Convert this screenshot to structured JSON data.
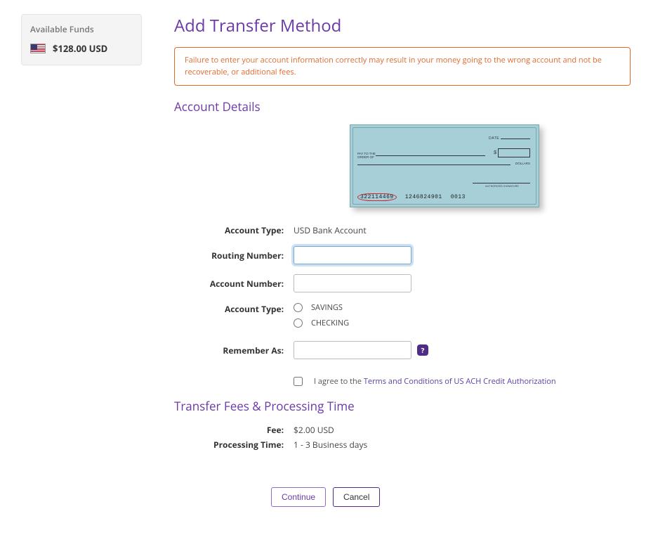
{
  "sidebar": {
    "funds_title": "Available Funds",
    "amount": "$128.00 USD"
  },
  "page_title": "Add Transfer Method",
  "alert": "Failure to enter your account information correctly may result in your money going to the wrong account and not be recoverable, or additional fees.",
  "section_account": "Account Details",
  "check": {
    "date_label": "DATE",
    "payto_line1": "PAY TO THE",
    "payto_line2": "ORDER OF",
    "dollar_sign": "$",
    "dollars_label": "DOLLARS",
    "sign_label": "AUTHORIZED SIGNATURE",
    "micr_routing": "322114469",
    "micr_account": "1246824901",
    "micr_check": "0013"
  },
  "form": {
    "account_type_label": "Account Type:",
    "account_type_value": "USD Bank Account",
    "routing_label": "Routing Number:",
    "routing_value": "",
    "account_num_label": "Account Number:",
    "account_num_value": "",
    "account_type2_label": "Account Type:",
    "savings": "SAVINGS",
    "checking": "CHECKING",
    "remember_label": "Remember As:",
    "remember_value": "",
    "help": "?",
    "agree_prefix": "I agree to the ",
    "agree_link": "Terms and Conditions of US ACH Credit Authorization"
  },
  "section_fees": "Transfer Fees & Processing Time",
  "fees": {
    "fee_label": "Fee:",
    "fee_value": "$2.00 USD",
    "time_label": "Processing Time:",
    "time_value": "1 - 3 Business days"
  },
  "actions": {
    "continue": "Continue",
    "cancel": "Cancel"
  }
}
